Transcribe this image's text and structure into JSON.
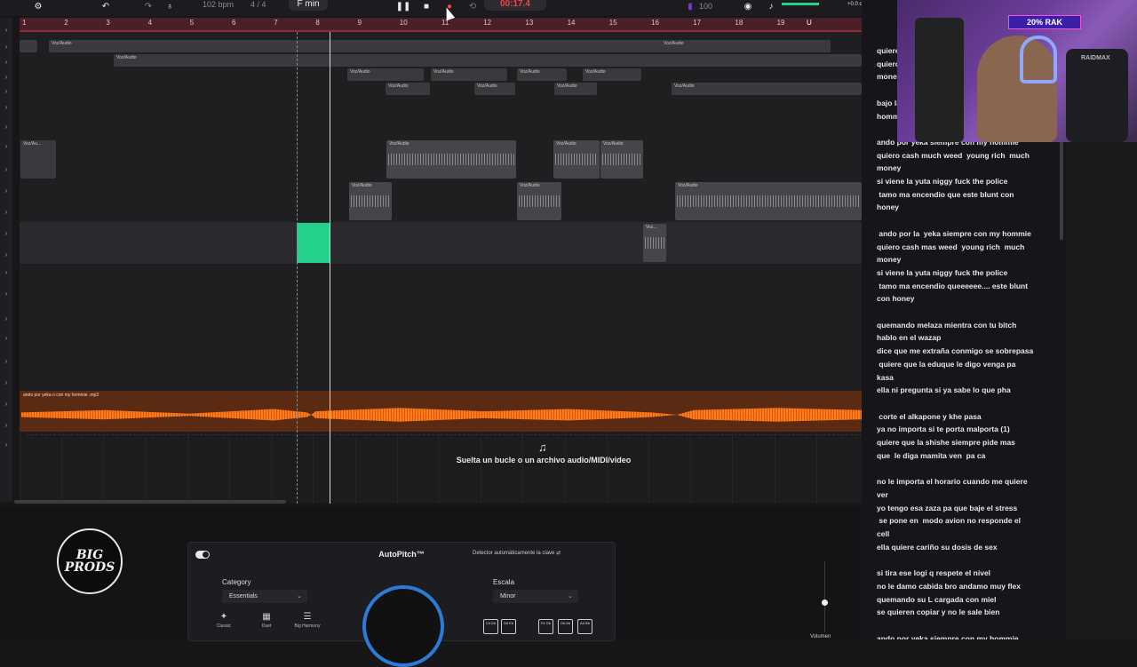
{
  "toolbar": {
    "tempo": "102",
    "tempo_unit": "bpm",
    "time_signature": "4 / 4",
    "key": "F min",
    "time": "00:17.4",
    "volume_db": "+0.0 dB",
    "zoom": "100"
  },
  "ruler": {
    "bars": [
      "1",
      "2",
      "3",
      "4",
      "5",
      "6",
      "7",
      "8",
      "9",
      "10",
      "11",
      "12",
      "13",
      "14",
      "15",
      "16",
      "17",
      "18",
      "19"
    ]
  },
  "clips": {
    "label": "Voz/Audio",
    "short_label": "Voz/Au...",
    "tiny_label": "Voz...",
    "master_track_label": "ando por yeka o con my hommie .mp3"
  },
  "drop_zone": {
    "text": "Suelta un bucle o un archivo audio/MIDI/video"
  },
  "logo": {
    "line1": "BIG",
    "line2": "PRODS"
  },
  "autopitch": {
    "title": "AutoPitch™",
    "detector": "Detector automáticamente la clave",
    "category_label": "Category",
    "category_value": "Essentials",
    "scale_label": "Escala",
    "scale_value": "Minor",
    "modes": [
      "Classic",
      "Duet",
      "Big Harmony"
    ],
    "keys": [
      "C#\nDb",
      "D#\nEb",
      "F#\nGb",
      "G#\nAb",
      "A#\nBb"
    ],
    "volume_label": "Volumen"
  },
  "webcam": {
    "sign": "20% RAK",
    "chair": "RAIDMAX"
  },
  "lyrics": {
    "text": "quiere\nquiero\nmoney\n\nbajo la\nhommie\n\nando por yeka siempre con my hommie\nquiero cash much weed  young rich  much\nmoney\nsi viene la yuta niggy fuck the police\n tamo ma encendio que este blunt con\nhoney\n\n ando por la  yeka siempre con my hommie\nquiero cash mas weed  young rich  much\nmoney\nsi viene la yuta niggy fuck the police\n tamo ma encendio queeeeee.... este blunt\ncon honey\n\nquemando melaza mientra con tu bitch\nhablo en el wazap\ndice que me extraña conmigo se sobrepasa\n quiere que la eduque le digo venga pa\nkasa\nella ni pregunta si ya sabe lo que pha\n\n corte el alkapone y khe pasa\nya no importa si te porta malporta (1)\nquiere que la shishe siempre pide mas\nque  le diga mamita ven  pa ca\n\nno le importa el horario cuando me quiere\nver\nyo tengo esa zaza pa que baje el stress\n se pone en  modo avion no responde el\ncell\nella quiere cariño su dosis de sex\n\nsi tira ese logi q respete el nivel\nno le damo cabida bro andamo muy flex\nquemando su L cargada con miel\nse quieren copiar y no le sale bien\n\nando por yeka siempre con my hommie"
  },
  "colors": {
    "accent": "#23d18b",
    "record": "#ff4040",
    "master_track": "#ff7a1a",
    "ruler": "#4a1f25",
    "knob": "#2d7bd8"
  },
  "icons": [
    "pause-icon",
    "stop-icon",
    "record-icon",
    "loop-icon",
    "magnet-icon",
    "music-note-icon",
    "headphones-icon",
    "undo-icon"
  ]
}
